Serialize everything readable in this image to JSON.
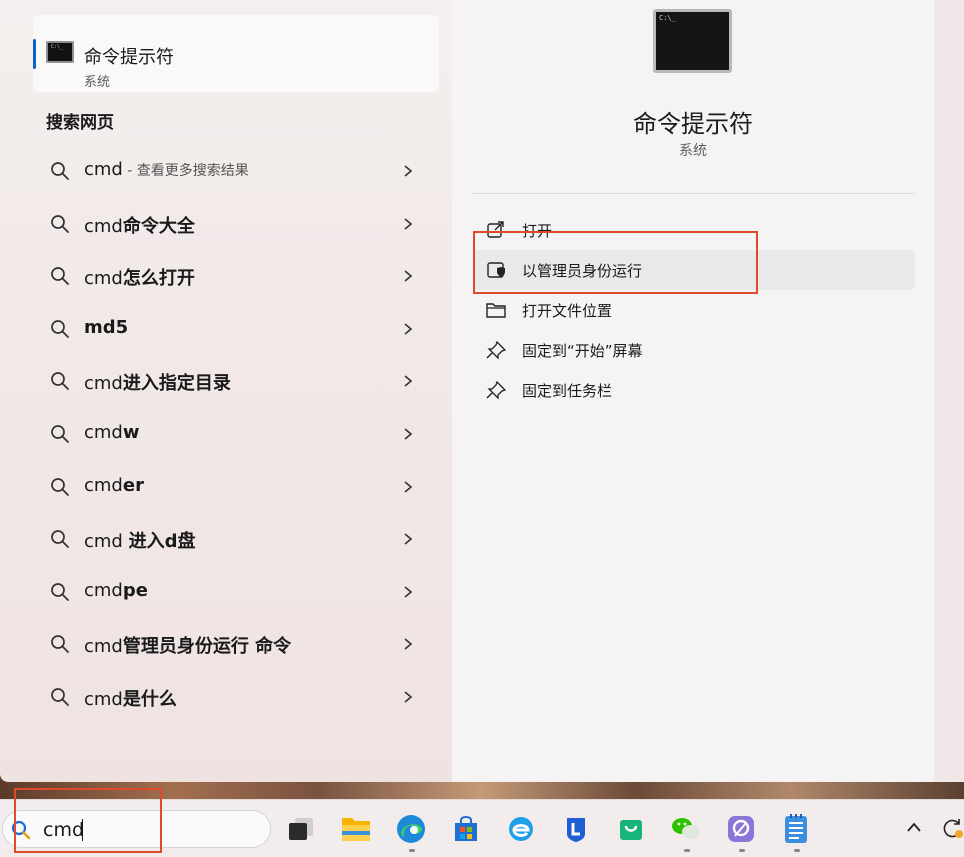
{
  "best_match": {
    "title": "命令提示符",
    "subtitle": "系统"
  },
  "web_section_title": "搜索网页",
  "results": [
    {
      "prefix": "cmd",
      "suffix": "",
      "hint": " - 查看更多搜索结果"
    },
    {
      "prefix": "cmd",
      "suffix": "命令大全",
      "hint": ""
    },
    {
      "prefix": "cmd",
      "suffix": "怎么打开",
      "hint": ""
    },
    {
      "prefix": "",
      "suffix": "md5",
      "hint": ""
    },
    {
      "prefix": "cmd",
      "suffix": "进入指定目录",
      "hint": ""
    },
    {
      "prefix": "cmd",
      "suffix": "w",
      "hint": ""
    },
    {
      "prefix": "cmd",
      "suffix": "er",
      "hint": ""
    },
    {
      "prefix": "cmd ",
      "suffix": "进入d盘",
      "hint": ""
    },
    {
      "prefix": "cmd",
      "suffix": "pe",
      "hint": ""
    },
    {
      "prefix": "cmd",
      "suffix": "管理员身份运行 命令",
      "hint": ""
    },
    {
      "prefix": "cmd",
      "suffix": "是什么",
      "hint": ""
    }
  ],
  "detail": {
    "title": "命令提示符",
    "subtitle": "系统",
    "actions": [
      {
        "label": "打开",
        "icon": "open-external-icon"
      },
      {
        "label": "以管理员身份运行",
        "icon": "shield-run-admin-icon"
      },
      {
        "label": "打开文件位置",
        "icon": "folder-icon"
      },
      {
        "label": "固定到“开始”屏幕",
        "icon": "pin-icon"
      },
      {
        "label": "固定到任务栏",
        "icon": "pin-icon"
      }
    ]
  },
  "taskbar": {
    "search_value": "cmd",
    "apps": [
      "task-view-icon",
      "file-explorer-icon",
      "edge-icon",
      "microsoft-store-icon",
      "ie-icon",
      "lenovo-icon",
      "shopping-bag-icon",
      "wechat-icon",
      "browser-icon",
      "notepad-icon"
    ]
  },
  "colors": {
    "accent": "#0a63c9",
    "highlight": "#e04a2c"
  }
}
